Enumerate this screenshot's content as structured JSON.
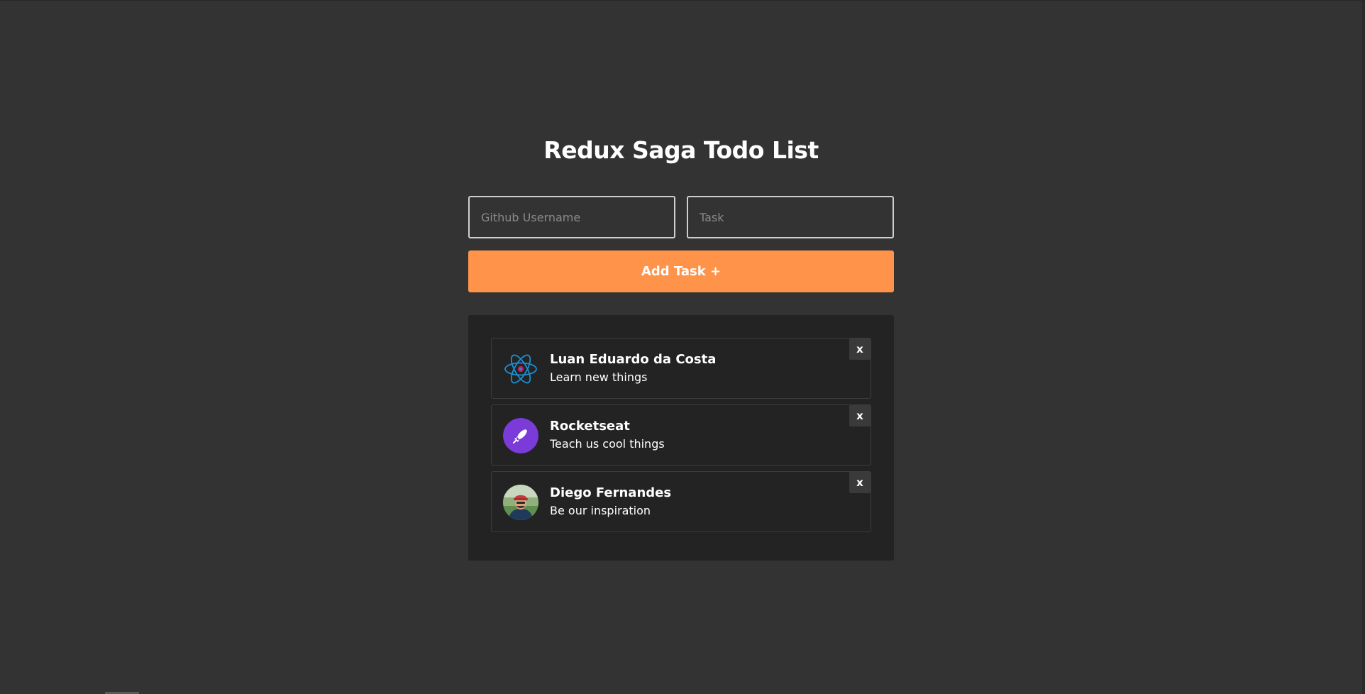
{
  "header": {
    "title": "Redux Saga Todo List"
  },
  "form": {
    "username_placeholder": "Github Username",
    "username_value": "",
    "task_placeholder": "Task",
    "task_value": "",
    "add_button_label": "Add Task +"
  },
  "tasks": [
    {
      "name": "Luan Eduardo da Costa",
      "description": "Learn new things",
      "avatar_icon": "react-atom-icon",
      "remove_label": "x"
    },
    {
      "name": "Rocketseat",
      "description": "Teach us cool things",
      "avatar_icon": "rocket-icon",
      "remove_label": "x"
    },
    {
      "name": "Diego Fernandes",
      "description": "Be our inspiration",
      "avatar_icon": "person-photo-avatar",
      "remove_label": "x"
    }
  ],
  "colors": {
    "background": "#333333",
    "panel": "#232323",
    "accent": "#ff934a",
    "rocketseat_purple": "#7a3bd9",
    "react_blue": "#1a8fd1"
  }
}
